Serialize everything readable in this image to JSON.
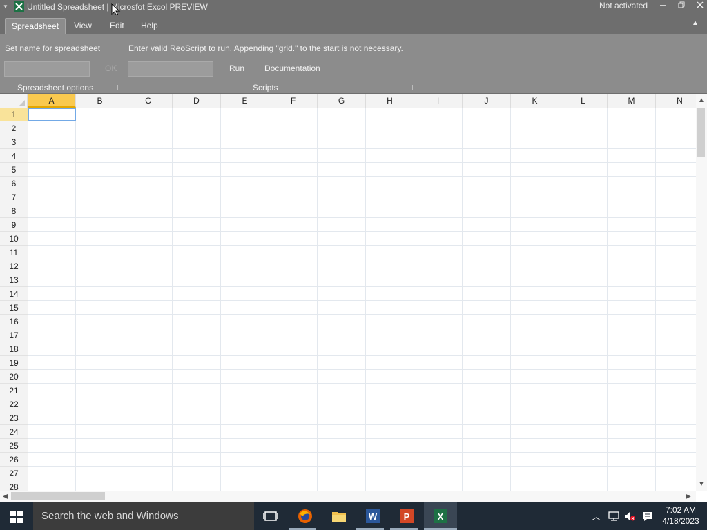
{
  "window": {
    "title": "Untitled Spreadsheet | Microsfot Excol PREVIEW",
    "activation_status": "Not activated",
    "controls": [
      "minimize",
      "restore",
      "close"
    ]
  },
  "ribbon": {
    "tabs": [
      {
        "label": "Spreadsheet",
        "active": true
      },
      {
        "label": "View",
        "active": false
      },
      {
        "label": "Edit",
        "active": false
      },
      {
        "label": "Help",
        "active": false
      }
    ],
    "spreadsheet_options": {
      "prompt": "Set name for spreadsheet",
      "name_input_value": "",
      "ok_label": "OK",
      "group_label": "Spreadsheet options"
    },
    "scripts": {
      "prompt": "Enter valid ReoScript to run. Appending \"grid.\" to the start is not necessary.",
      "script_input_value": "",
      "run_label": "Run",
      "documentation_label": "Documentation",
      "group_label": "Scripts"
    }
  },
  "grid": {
    "columns": [
      "A",
      "B",
      "C",
      "D",
      "E",
      "F",
      "G",
      "H",
      "I",
      "J",
      "K",
      "L",
      "M",
      "N"
    ],
    "rows": [
      "1",
      "2",
      "3",
      "4",
      "5",
      "6",
      "7",
      "8",
      "9",
      "10",
      "11",
      "12",
      "13",
      "14",
      "15",
      "16",
      "17",
      "18",
      "19",
      "20",
      "21",
      "22",
      "23",
      "24",
      "25",
      "26",
      "27",
      "28"
    ],
    "selected_cell": "A1"
  },
  "taskbar": {
    "search_placeholder": "Search the web and Windows",
    "apps": [
      "task-view-icon",
      "firefox-icon",
      "file-explorer-icon",
      "word-icon",
      "powerpoint-icon",
      "excol-icon"
    ],
    "clock_time": "7:02 AM",
    "clock_date": "4/18/2023"
  },
  "colors": {
    "chrome_dark": "#6e6e6e",
    "ribbon_bg": "#8c8c8c",
    "selected_header": "#f9c94f",
    "active_cell_border": "#73a9e6",
    "taskbar_bg": "#1f2a36"
  }
}
